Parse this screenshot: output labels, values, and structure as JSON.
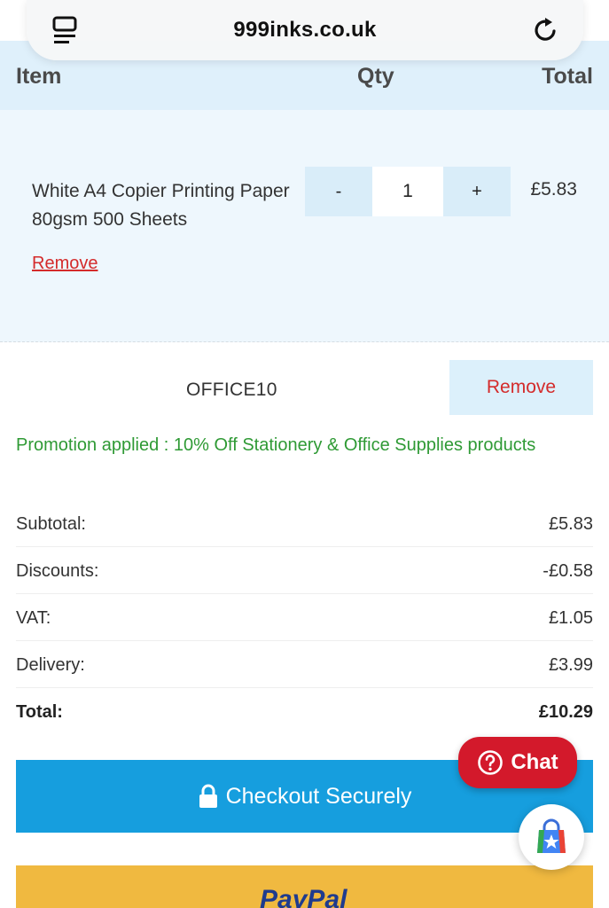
{
  "browser": {
    "domain": "999inks.co.uk"
  },
  "cart": {
    "headers": {
      "item": "Item",
      "qty": "Qty",
      "total": "Total"
    },
    "items": [
      {
        "name": "White A4 Copier Printing Paper 80gsm 500 Sheets",
        "qty": "1",
        "minus": "-",
        "plus": "+",
        "total": "£5.83",
        "remove_label": "Remove"
      }
    ]
  },
  "coupon": {
    "code": "OFFICE10",
    "remove_label": "Remove",
    "promotion": "Promotion applied : 10% Off Stationery & Office Supplies products"
  },
  "summary": {
    "subtotal_label": "Subtotal:",
    "subtotal": "£5.83",
    "discounts_label": "Discounts:",
    "discounts": "-£0.58",
    "vat_label": "VAT:",
    "vat": "£1.05",
    "delivery_label": "Delivery:",
    "delivery": "£3.99",
    "total_label": "Total:",
    "total": "£10.29"
  },
  "checkout": {
    "label": "Checkout Securely"
  },
  "paypal": {
    "label_pay": "PayPal"
  },
  "chat": {
    "label": "Chat"
  },
  "colors": {
    "accent": "#169ede",
    "remove_red": "#d42b2b",
    "promo_green": "#2f9a35",
    "chat_red": "#d3192b",
    "paypal_gold": "#f0b940"
  }
}
